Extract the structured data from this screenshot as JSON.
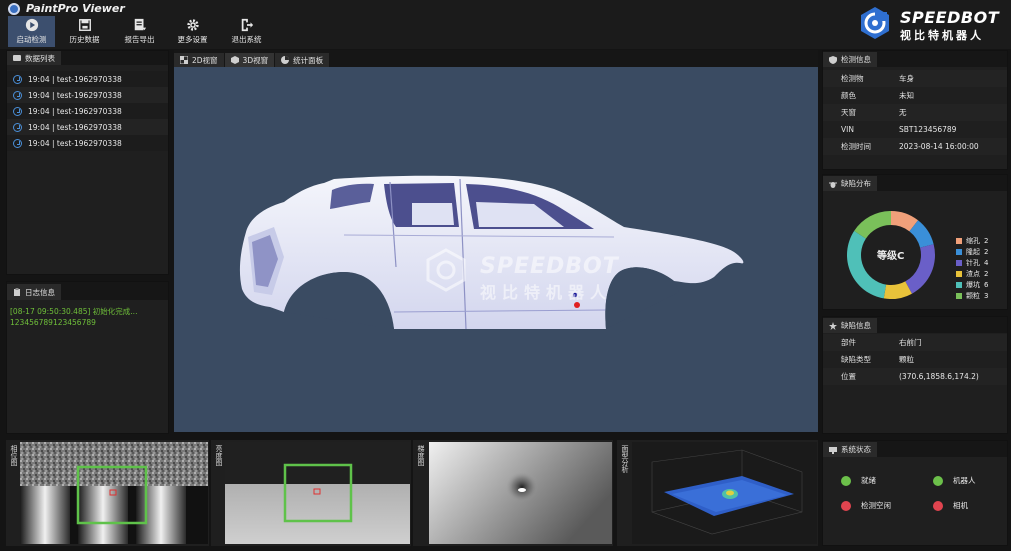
{
  "app": {
    "title": "PaintPro Viewer"
  },
  "toolbar": [
    {
      "label": "启动检测",
      "icon": "play-icon",
      "active": true
    },
    {
      "label": "历史数据",
      "icon": "history-icon",
      "active": false
    },
    {
      "label": "报告导出",
      "icon": "report-icon",
      "active": false
    },
    {
      "label": "更多设置",
      "icon": "gear-icon",
      "active": false
    },
    {
      "label": "退出系统",
      "icon": "exit-icon",
      "active": false
    }
  ],
  "brand": {
    "name": "SPEEDBOT",
    "sub": "视比特机器人"
  },
  "data_list": {
    "title": "数据列表",
    "items": [
      "19:04 | test-1962970338",
      "19:04 | test-1962970338",
      "19:04 | test-1962970338",
      "19:04 | test-1962970338",
      "19:04 | test-1962970338"
    ]
  },
  "log": {
    "title": "日志信息",
    "lines": [
      "[08-17 09:50:30.485] 初始化完成...",
      "123456789123456789"
    ],
    "color": "#6fbf3a"
  },
  "view_tabs": [
    "2D视窗",
    "3D视窗",
    "统计面板"
  ],
  "watermark": {
    "name": "SPEEDBOT",
    "sub": "视比特机器人"
  },
  "inspection": {
    "title": "检测信息",
    "rows": [
      {
        "k": "检测物",
        "v": "车身"
      },
      {
        "k": "颜色",
        "v": "未知"
      },
      {
        "k": "天窗",
        "v": "无"
      },
      {
        "k": "VIN",
        "v": "SBT123456789"
      },
      {
        "k": "检测时间",
        "v": "2023-08-14 16:00:00"
      }
    ]
  },
  "defect_dist": {
    "title": "缺陷分布",
    "center": "等级C",
    "items": [
      {
        "name": "缩孔",
        "count": 2,
        "color": "#f0a07a"
      },
      {
        "name": "隆起",
        "count": 2,
        "color": "#3a8fd8"
      },
      {
        "name": "针孔",
        "count": 4,
        "color": "#6a5fc8"
      },
      {
        "name": "渣点",
        "count": 2,
        "color": "#e8c23a"
      },
      {
        "name": "爆坑",
        "count": 6,
        "color": "#4fc0b8"
      },
      {
        "name": "颗粒",
        "count": 3,
        "color": "#7ac05a"
      }
    ]
  },
  "defect_info": {
    "title": "缺陷信息",
    "rows": [
      {
        "k": "部件",
        "v": "右前门"
      },
      {
        "k": "缺陷类型",
        "v": "颗粒"
      },
      {
        "k": "位置",
        "v": "(370.6,1858.6,174.2)"
      }
    ]
  },
  "thumbs": [
    {
      "label": "相位图"
    },
    {
      "label": "亮度图"
    },
    {
      "label": "梯度图"
    },
    {
      "label": "面型分析"
    }
  ],
  "system": {
    "title": "系统状态",
    "items": [
      {
        "label": "就绪",
        "color": "#6cc04a"
      },
      {
        "label": "机器人",
        "color": "#6cc04a"
      },
      {
        "label": "检测空闲",
        "color": "#e0444f"
      },
      {
        "label": "相机",
        "color": "#e0444f"
      }
    ]
  }
}
